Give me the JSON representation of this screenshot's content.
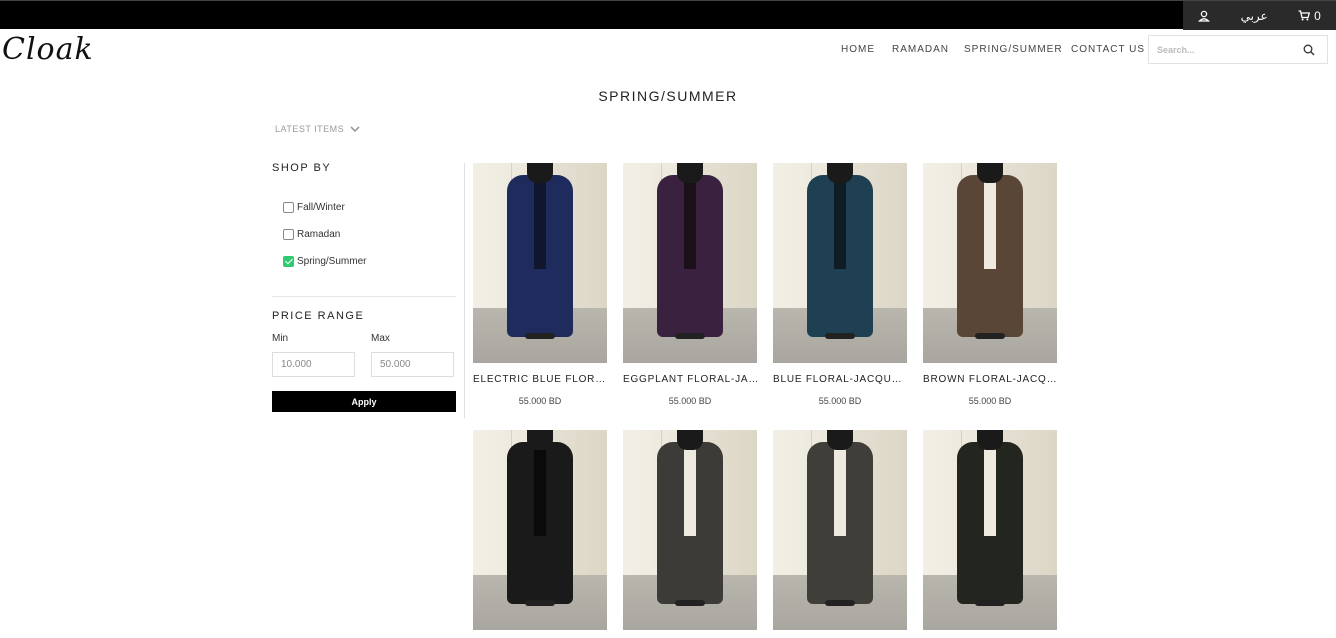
{
  "topbar": {
    "language": "عربي",
    "cart_count": "0"
  },
  "brand": {
    "logo_text": "Cloak"
  },
  "nav": {
    "items": [
      "HOME",
      "RAMADAN",
      "SPRING/SUMMER",
      "CONTACT US"
    ]
  },
  "search": {
    "placeholder": "Search..."
  },
  "page": {
    "title": "SPRING/SUMMER",
    "sort_label": "LATEST ITEMS"
  },
  "sidebar": {
    "shop_by_title": "SHOP BY",
    "filters": [
      {
        "label": "Fall/Winter",
        "checked": false
      },
      {
        "label": "Ramadan",
        "checked": false
      },
      {
        "label": "Spring/Summer",
        "checked": true
      }
    ],
    "price_range_title": "PRICE RANGE",
    "min_label": "Min",
    "max_label": "Max",
    "min_value": "10.000",
    "max_value": "50.000",
    "apply_label": "Apply"
  },
  "products": [
    {
      "name": "ELECTRIC BLUE FLORAL-JACQUARD",
      "price": "55.000 BD",
      "color": "#1e2b5c",
      "inner": "#10162e"
    },
    {
      "name": "EGGPLANT FLORAL-JACQUARD",
      "price": "55.000 BD",
      "color": "#3a2140",
      "inner": "#1a1018"
    },
    {
      "name": "BLUE FLORAL-JACQUARD",
      "price": "55.000 BD",
      "color": "#1f3f52",
      "inner": "#0f1c24"
    },
    {
      "name": "BROWN FLORAL-JACQUARD",
      "price": "55.000 BD",
      "color": "#5a4636",
      "inner": "#efeae0"
    },
    {
      "name": "",
      "price": "",
      "color": "#1a1a1a",
      "inner": "#0a0a0a"
    },
    {
      "name": "",
      "price": "",
      "color": "#3c3b37",
      "inner": "#efeae0"
    },
    {
      "name": "",
      "price": "",
      "color": "#403e39",
      "inner": "#efeae0"
    },
    {
      "name": "",
      "price": "",
      "color": "#23261f",
      "inner": "#efeae0"
    }
  ]
}
